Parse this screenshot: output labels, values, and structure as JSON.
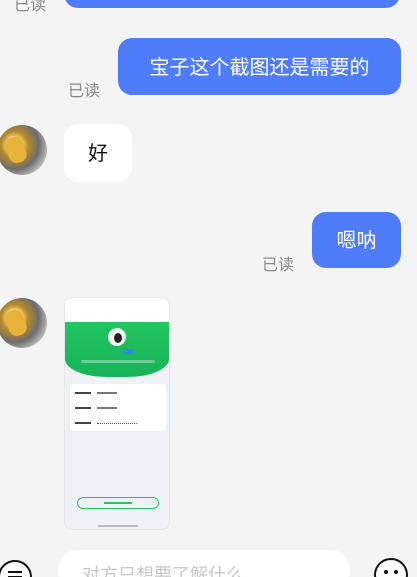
{
  "messages": [
    {
      "id": "m0",
      "direction": "out",
      "text": "",
      "status": "已读"
    },
    {
      "id": "m1",
      "direction": "out",
      "text": "宝子这个截图还是需要的",
      "status": "已读"
    },
    {
      "id": "m2",
      "direction": "in",
      "text": "好"
    },
    {
      "id": "m3",
      "direction": "out",
      "text": "嗯呐",
      "status": "已读"
    },
    {
      "id": "m4",
      "direction": "in",
      "type": "image",
      "alt_label": "screenshot-image"
    }
  ],
  "input": {
    "placeholder": "对方只想要了解什么"
  },
  "colors": {
    "background": "#f4f4f5",
    "outgoing_bubble": "#4f7cfb",
    "incoming_bubble": "#ffffff",
    "read_text": "#8a8a8a"
  },
  "icons": [
    "menu-icon",
    "emoji-icon"
  ]
}
